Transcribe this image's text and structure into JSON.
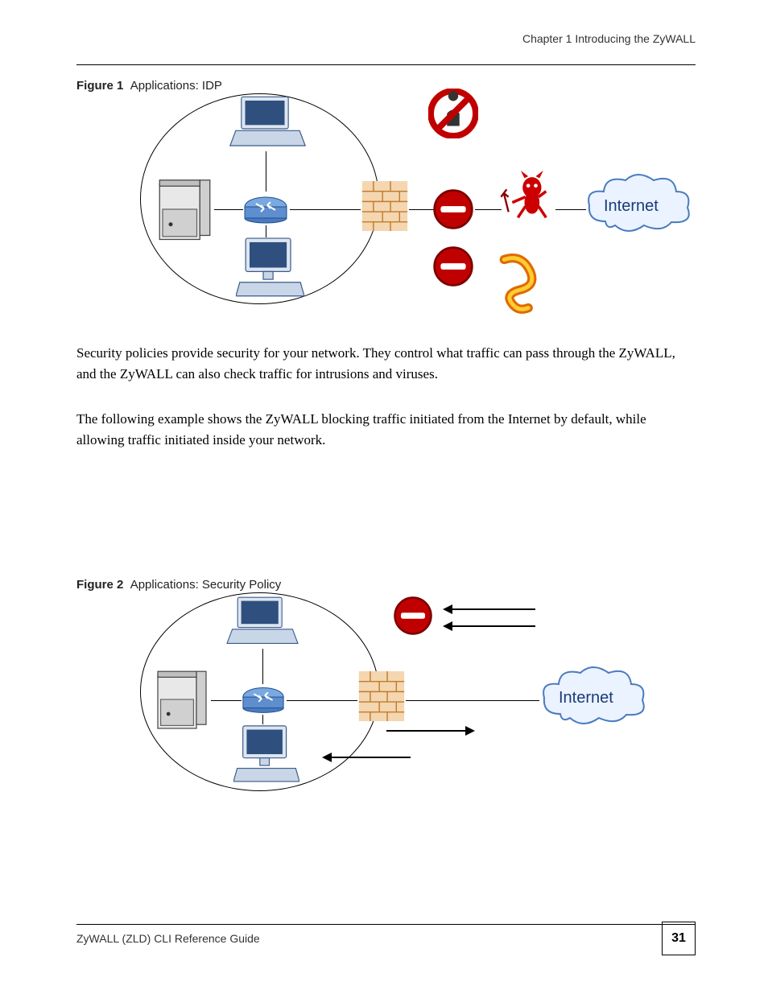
{
  "header": {
    "right": "Chapter 1 Introducing the ZyWALL"
  },
  "figure1": {
    "label": "Figure 1",
    "caption": "Applications: IDP",
    "cloud_label": "Internet"
  },
  "paragraphs": {
    "p1": "Security policies provide security for your network. They control what traffic can pass through the ZyWALL, and the ZyWALL can also check traffic for intrusions and viruses.",
    "p2": "The following example shows the ZyWALL blocking traffic initiated from the Internet by default, while allowing traffic initiated inside your network."
  },
  "figure2": {
    "label": "Figure 2",
    "caption": "Applications: Security Policy",
    "cloud_label": "Internet"
  },
  "footer": {
    "text": "ZyWALL (ZLD) CLI Reference Guide",
    "page": "31"
  }
}
